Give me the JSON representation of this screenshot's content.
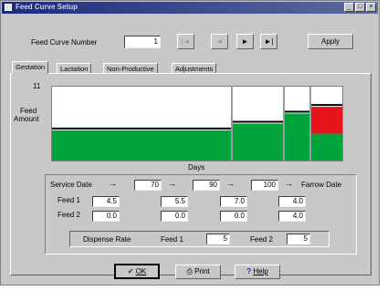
{
  "window": {
    "title": "Feed Curve Setup"
  },
  "header": {
    "feed_curve_label": "Feed Curve Number",
    "feed_curve_value": "1",
    "apply_label": "Apply",
    "nav": {
      "first": "|◄",
      "prev": "◄",
      "next": "►",
      "last": "►|"
    }
  },
  "tabs": [
    "Gestation",
    "Lactation",
    "Non-Productive",
    "Adjustments"
  ],
  "chart": {
    "y_max_label": "11",
    "y_label_line1": "Feed",
    "y_label_line2": "Amount",
    "x_label": "Days",
    "colors": {
      "green": "#00a43c",
      "red": "#e8141c",
      "line": "#000000"
    }
  },
  "chart_data": {
    "type": "bar",
    "ylim": [
      0,
      11
    ],
    "segments": [
      {
        "feed1": 4.5,
        "feed2": 0.0
      },
      {
        "feed1": 5.5,
        "feed2": 0.0
      },
      {
        "feed1": 7.0,
        "feed2": 0.0
      },
      {
        "feed1": 4.0,
        "feed2": 4.0
      }
    ]
  },
  "schedule": {
    "service_date_label": "Service Date",
    "farrow_date_label": "Farrow Date",
    "arrow": "→",
    "days": [
      "70",
      "90",
      "100"
    ],
    "feed1_label": "Feed 1",
    "feed2_label": "Feed 2",
    "feed1": [
      "4.5",
      "5.5",
      "7.0",
      "4.0"
    ],
    "feed2": [
      "0.0",
      "0.0",
      "0.0",
      "4.0"
    ]
  },
  "dispense": {
    "label": "Dispense Rate",
    "feed1_label": "Feed 1",
    "feed1_value": "5",
    "feed2_label": "Feed 2",
    "feed2_value": "5"
  },
  "footer": {
    "ok_label": "OK",
    "print_label": "Print",
    "help_label": "Help"
  }
}
